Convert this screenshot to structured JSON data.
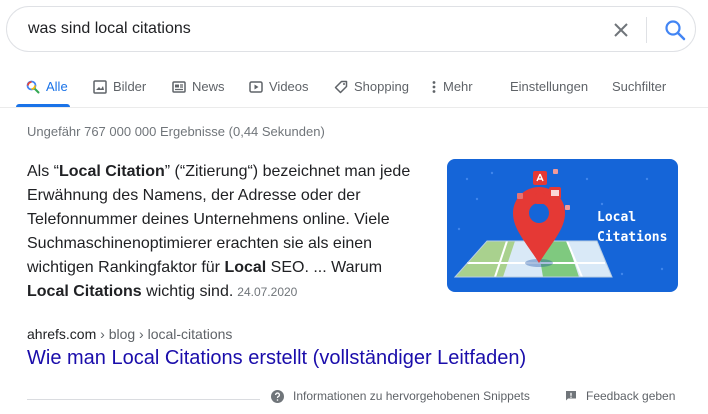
{
  "search": {
    "query": "was sind local citations"
  },
  "tabs": [
    {
      "label": "Alle",
      "icon": "search-icon",
      "active": true
    },
    {
      "label": "Bilder",
      "icon": "image-icon"
    },
    {
      "label": "News",
      "icon": "news-icon"
    },
    {
      "label": "Videos",
      "icon": "video-icon"
    },
    {
      "label": "Shopping",
      "icon": "tag-icon"
    },
    {
      "label": "Mehr",
      "icon": "more-vert-icon"
    },
    {
      "label": "Einstellungen"
    },
    {
      "label": "Suchfilter"
    }
  ],
  "result_stats": "Ungefähr 767 000 000 Ergebnisse (0,44 Sekunden)",
  "snippet": {
    "parts": [
      {
        "text": "Als “",
        "bold": false
      },
      {
        "text": "Local Citation",
        "bold": true
      },
      {
        "text": "” (“Zitierung“) bezeichnet man jede Erwähnung des Namens, der Adresse oder der Telefonnummer deines Unternehmens online. Viele Suchmaschinenoptimierer erachten sie als einen wichtigen Rankingfaktor für ",
        "bold": false
      },
      {
        "text": "Local",
        "bold": true
      },
      {
        "text": " SEO. ... Warum ",
        "bold": false
      },
      {
        "text": "Local Citations",
        "bold": true
      },
      {
        "text": " wichtig sind.",
        "bold": false
      }
    ],
    "date": "24.07.2020"
  },
  "thumbnail": {
    "title_line1": "Local",
    "title_line2": "Citations",
    "bg_color": "#1565d8"
  },
  "result": {
    "domain": "ahrefs.com",
    "path": " › blog › local-citations",
    "title": "Wie man Local Citations erstellt (vollständiger Leitfaden)"
  },
  "footer": {
    "info_label": "Informationen zu hervorgehobenen Snippets",
    "feedback_label": "Feedback geben"
  },
  "colors": {
    "link": "#1a0dab",
    "accent": "#1a73e8",
    "muted": "#70757a"
  }
}
